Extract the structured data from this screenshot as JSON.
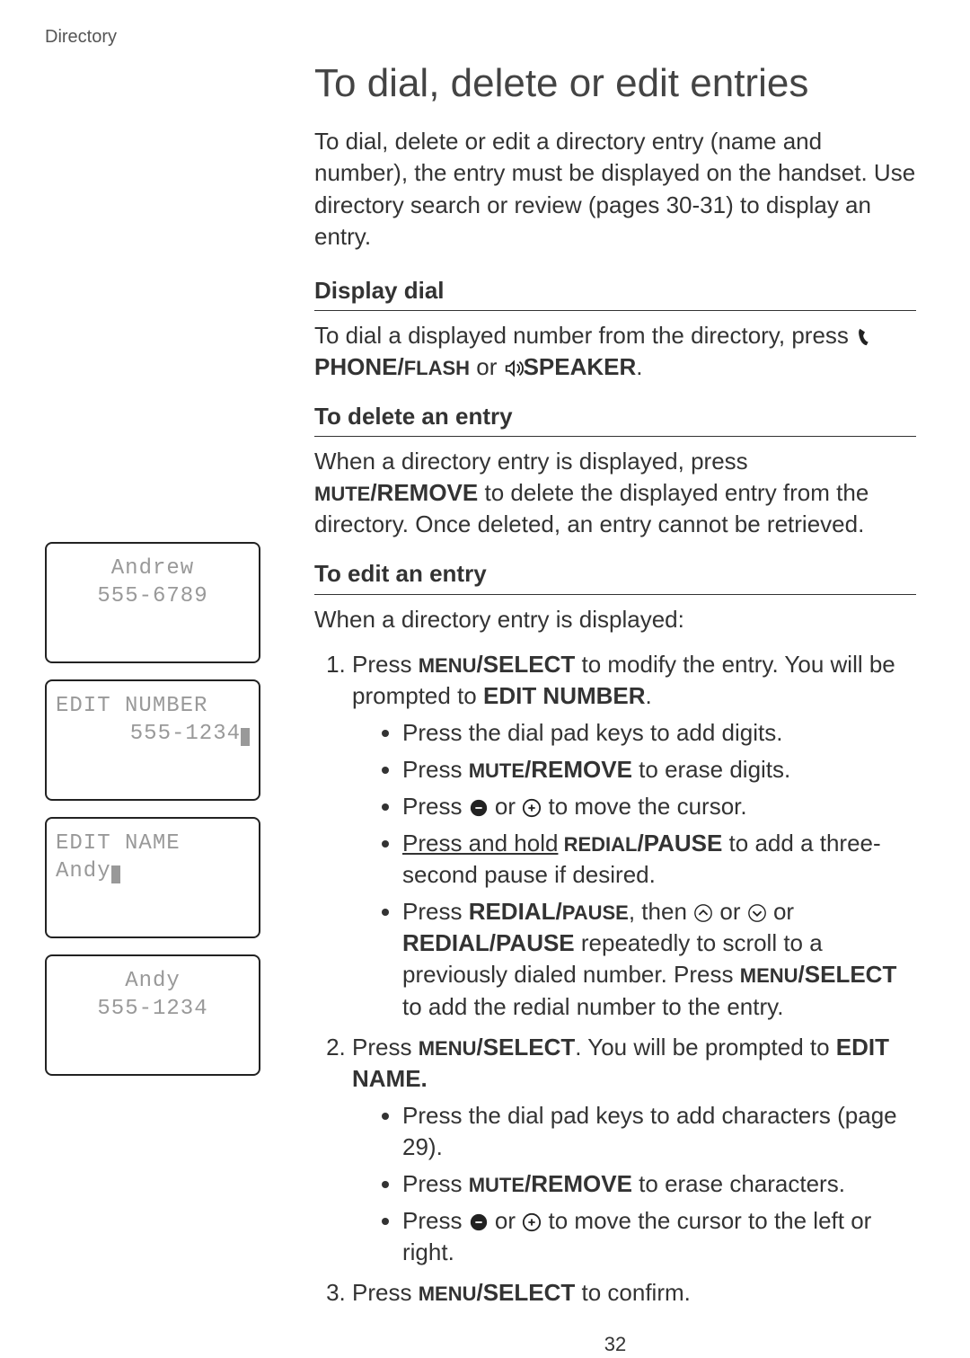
{
  "header": {
    "label": "Directory"
  },
  "title": "To dial, delete or edit entries",
  "intro": "To dial, delete or edit a directory entry (name and number), the entry must be displayed on the handset. Use directory search or review (pages 30-31) to display an entry.",
  "sections": {
    "display_dial": {
      "heading": "Display dial",
      "text_a": "To dial a displayed number from the directory, press ",
      "phone_label": "PHONE/",
      "phone_flash": "FLASH",
      "or": " or ",
      "speaker_label": "SPEAKER",
      "period": "."
    },
    "delete": {
      "heading": "To delete an entry",
      "text_a": "When a directory entry is displayed, press ",
      "mute_sc": "MUTE",
      "remove_b": "/REMOVE",
      "text_b": " to delete the displayed entry from the directory. Once deleted, an entry cannot be retrieved."
    },
    "edit": {
      "heading": "To edit an entry",
      "intro": "When a directory entry is displayed:",
      "step1": {
        "a": "Press ",
        "menu_sc": "MENU",
        "select_b": "/SELECT",
        "b": " to modify the entry. You will be prompted to ",
        "edit_number": "EDIT NUMBER",
        "c": ".",
        "b1": "Press the dial pad keys to add digits.",
        "b2_a": "Press ",
        "b2_mute": "MUTE",
        "b2_remove": "/REMOVE",
        "b2_b": " to erase digits.",
        "b3_a": "Press ",
        "b3_b": " or ",
        "b3_c": " to move the cursor.",
        "b4_a": "Press and hold",
        "b4_redial_sc": " REDIAL",
        "b4_pause_b": "/PAUSE",
        "b4_b": " to add a three-second pause if desired.",
        "b5_a": "Press ",
        "b5_redial_b": "REDIAL/",
        "b5_pause_sc": "PAUSE",
        "b5_b": ", then ",
        "b5_c": " or ",
        "b5_d": " or ",
        "b5_redial_pause": "REDIAL/PAUSE",
        "b5_e": " repeatedly to scroll to a previously dialed number. Press ",
        "b5_menu": "MENU",
        "b5_select": "/SELECT",
        "b5_f": " to add the redial number to the entry."
      },
      "step2": {
        "a": "Press ",
        "menu_sc": "MENU",
        "select_b": "/SELECT",
        "b": ". You will be prompted to ",
        "edit_name": "EDIT NAME.",
        "b1": "Press the dial pad keys to add characters (page 29).",
        "b2_a": "Press ",
        "b2_mute": "MUTE",
        "b2_remove": "/REMOVE",
        "b2_b": " to erase characters.",
        "b3_a": "Press ",
        "b3_b": " or ",
        "b3_c": " to move the cursor to the left or right."
      },
      "step3": {
        "a": "Press ",
        "menu_sc": "MENU",
        "select_b": "/SELECT",
        "b": " to confirm."
      }
    }
  },
  "lcds": {
    "l1_name": "Andrew",
    "l1_num": "555-6789",
    "l2_label": "EDIT NUMBER",
    "l2_num": "555-1234",
    "l3_label": "EDIT NAME",
    "l3_name": "Andy",
    "l4_name": "Andy",
    "l4_num": "555-1234"
  },
  "page_number": "32",
  "icons": {
    "handset": "handset-icon",
    "speaker": "speaker-icon",
    "vol_down": "volume-down-icon",
    "vol_up": "volume-up-icon",
    "cid_up": "cid-up-icon",
    "cid_down": "cid-down-icon"
  }
}
